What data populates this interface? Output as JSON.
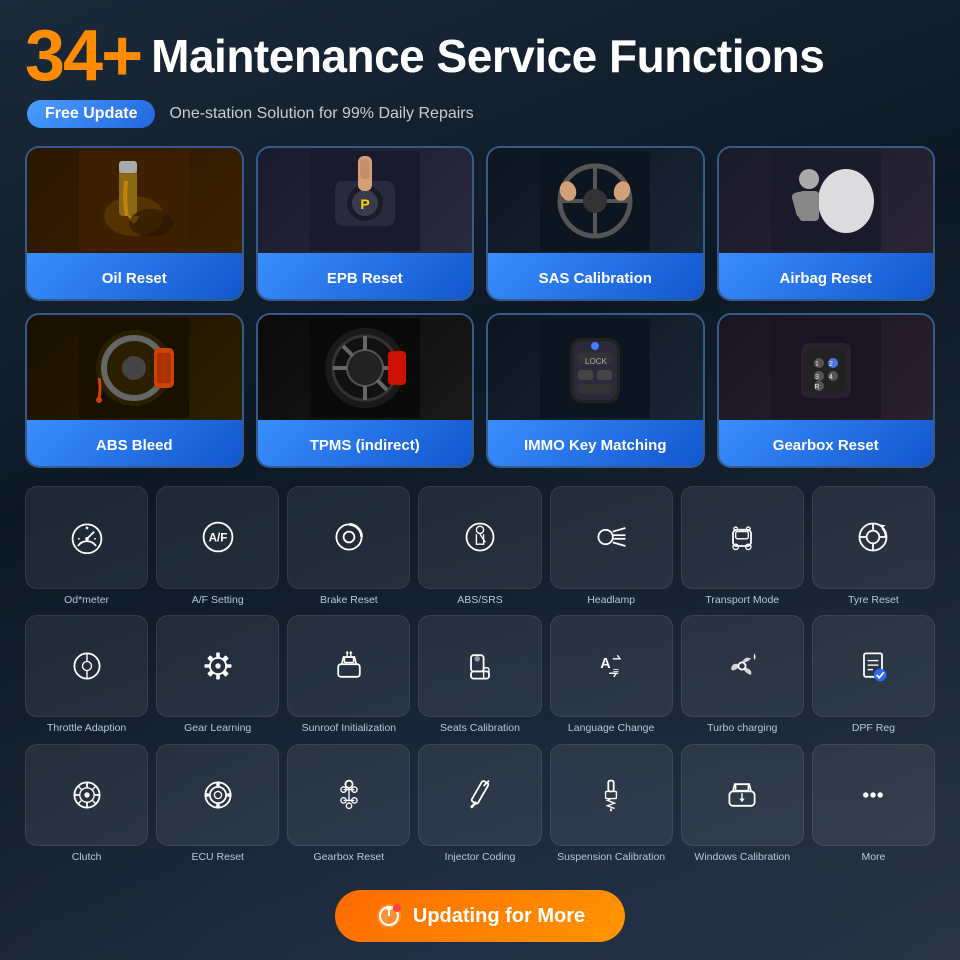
{
  "header": {
    "number": "34+",
    "title": "Maintenance Service Functions",
    "badge": "Free Update",
    "subtitle": "One-station Solution for 99% Daily Repairs"
  },
  "mainCards": [
    {
      "id": "oil-reset",
      "label": "Oil Reset",
      "emoji": "🔧"
    },
    {
      "id": "epb-reset",
      "label": "EPB Reset",
      "emoji": "🅿️"
    },
    {
      "id": "sas-calibration",
      "label": "SAS Calibration",
      "emoji": "🎯"
    },
    {
      "id": "airbag-reset",
      "label": "Airbag Reset",
      "emoji": "💨"
    },
    {
      "id": "abs-bleed",
      "label": "ABS Bleed",
      "emoji": "⚙️"
    },
    {
      "id": "tpms",
      "label": "TPMS (indirect)",
      "emoji": "🔵"
    },
    {
      "id": "immo",
      "label": "IMMO Key Matching",
      "emoji": "🔑"
    },
    {
      "id": "gearbox-reset",
      "label": "Gearbox Reset",
      "emoji": "⚙️"
    }
  ],
  "row1": [
    {
      "id": "odometer",
      "label": "Od*meter"
    },
    {
      "id": "af-setting",
      "label": "A/F Setting"
    },
    {
      "id": "brake-reset",
      "label": "Brake Reset"
    },
    {
      "id": "abs-srs",
      "label": "ABS/SRS"
    },
    {
      "id": "headlamp",
      "label": "Headlamp"
    },
    {
      "id": "transport-mode",
      "label": "Transport Mode"
    },
    {
      "id": "tyre-reset",
      "label": "Tyre Reset"
    }
  ],
  "row2": [
    {
      "id": "throttle",
      "label": "Throttle Adaption"
    },
    {
      "id": "gear-learning",
      "label": "Gear Learning"
    },
    {
      "id": "sunroof",
      "label": "Sunroof Initialization"
    },
    {
      "id": "seats",
      "label": "Seats Calibration"
    },
    {
      "id": "language",
      "label": "Language Change"
    },
    {
      "id": "turbo",
      "label": "Turbo charging"
    },
    {
      "id": "dpf",
      "label": "DPF Reg"
    }
  ],
  "row3": [
    {
      "id": "clutch",
      "label": "Clutch"
    },
    {
      "id": "ecu-reset",
      "label": "ECU Reset"
    },
    {
      "id": "gearbox2",
      "label": "Gearbox Reset"
    },
    {
      "id": "injector",
      "label": "Injector Coding"
    },
    {
      "id": "suspension",
      "label": "Suspension Calibration"
    },
    {
      "id": "windows",
      "label": "Windows Calibration"
    },
    {
      "id": "more",
      "label": "More"
    }
  ],
  "updateButton": "Updating for More"
}
